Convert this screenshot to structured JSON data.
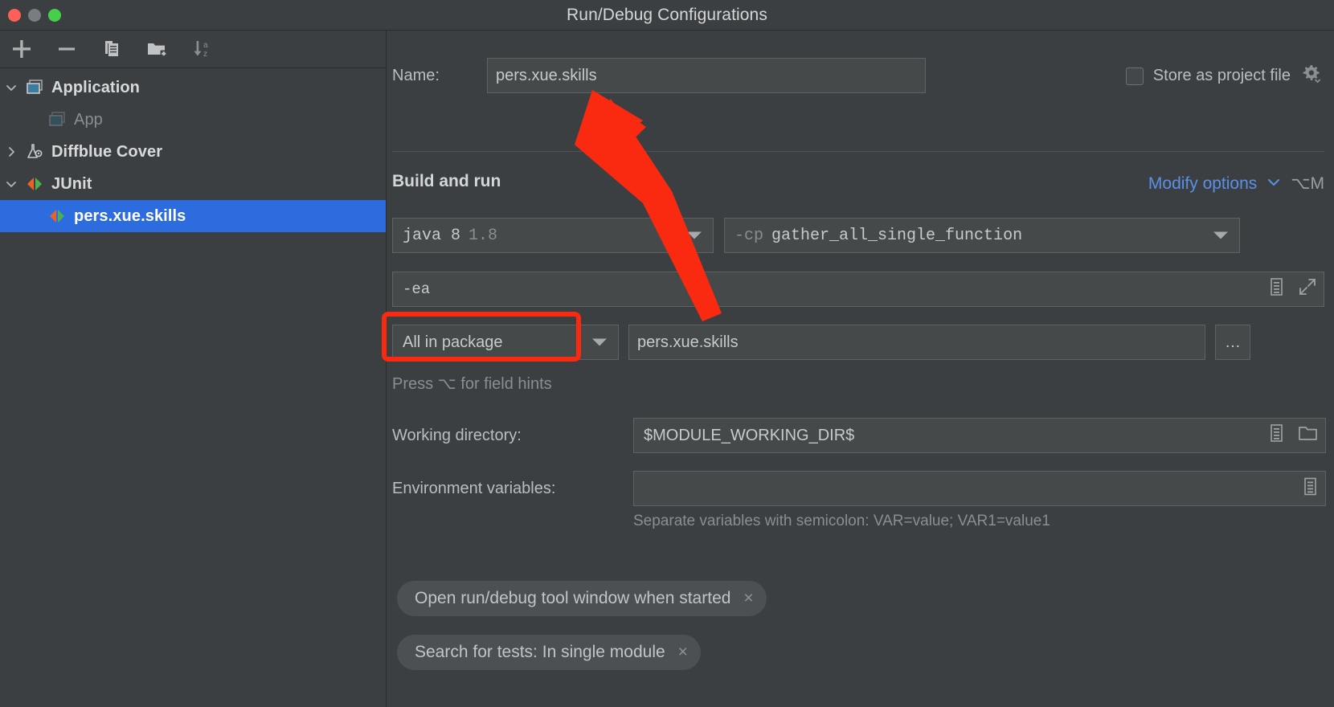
{
  "window": {
    "title": "Run/Debug Configurations",
    "traffic_lights": [
      "close-red",
      "minimize-yellow",
      "zoom-green"
    ]
  },
  "sidebar": {
    "toolbar": [
      {
        "name": "add-button",
        "icon": "plus-icon"
      },
      {
        "name": "remove-button",
        "icon": "minus-icon"
      },
      {
        "name": "copy-configuration-button",
        "icon": "copy-icon"
      },
      {
        "name": "save-configuration-button",
        "icon": "folder-add-icon"
      },
      {
        "name": "sort-configurations-button",
        "icon": "sort-az-icon"
      }
    ],
    "tree": [
      {
        "label": "Application",
        "icon": "application-icon",
        "twisty": "chevron-down",
        "indent": 0,
        "selected": false,
        "dim": false
      },
      {
        "label": "App",
        "icon": "application-icon-dim",
        "twisty": "",
        "indent": 1,
        "selected": false,
        "dim": true
      },
      {
        "label": "Diffblue Cover",
        "icon": "diffblue-flask-icon",
        "twisty": "chevron-right",
        "indent": 0,
        "selected": false,
        "dim": false
      },
      {
        "label": "JUnit",
        "icon": "junit-icon",
        "twisty": "chevron-down",
        "indent": 0,
        "selected": false,
        "dim": false
      },
      {
        "label": "pers.xue.skills",
        "icon": "junit-icon",
        "twisty": "",
        "indent": 1,
        "selected": true,
        "dim": false
      }
    ]
  },
  "main": {
    "name_label": "Name:",
    "name_value": "pers.xue.skills",
    "store_as_project_file_label": "Store as project file",
    "store_as_project_file_checked": false,
    "gear_icon": "gear-dropdown-icon",
    "section_title": "Build and run",
    "modify_options_label": "Modify options",
    "modify_options_shortcut": "⌥M",
    "jre": {
      "name": "java 8",
      "version": "1.8"
    },
    "classpath": {
      "prefix": "-cp",
      "module": "gather_all_single_function"
    },
    "vm_options": "-ea",
    "scope_value": "All in package",
    "package_value": "pers.xue.skills",
    "browse_button_label": "…",
    "field_hint": "Press ⌥ for field hints",
    "working_directory_label": "Working directory:",
    "working_directory_value": "$MODULE_WORKING_DIR$",
    "environment_variables_label": "Environment variables:",
    "environment_variables_value": "",
    "environment_variables_hint": "Separate variables with semicolon: VAR=value; VAR1=value1",
    "chips": [
      {
        "label": "Open run/debug tool window when started",
        "close": "×"
      },
      {
        "label": "Search for tests: In single module",
        "close": "×"
      }
    ]
  },
  "colors": {
    "window_bg": "#3c3f41",
    "field_bg": "#45494a",
    "selection_blue": "#2d6cdf",
    "link_blue": "#5a91e8",
    "annotation_red": "#fa2a10",
    "text_primary": "#d5d6d7",
    "text_muted": "#8b8e90"
  },
  "annotations": {
    "arrow": {
      "name": "red-pointer-arrow",
      "color": "#fa2a10",
      "points_to": "name_value"
    },
    "highlight": {
      "name": "red-highlight-box",
      "color": "#fa2a10",
      "around": "scope_value"
    }
  }
}
